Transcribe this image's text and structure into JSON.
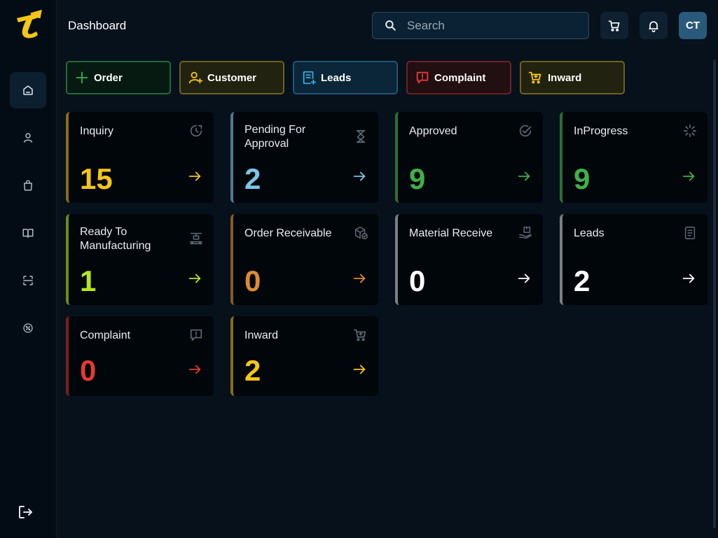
{
  "header": {
    "title": "Dashboard",
    "search_placeholder": "Search",
    "avatar_initials": "CT"
  },
  "sidebar": {
    "items": [
      {
        "name": "home-icon",
        "active": true
      },
      {
        "name": "user-icon",
        "active": false
      },
      {
        "name": "bag-icon",
        "active": false
      },
      {
        "name": "book-icon",
        "active": false
      },
      {
        "name": "scan-icon",
        "active": false
      },
      {
        "name": "discount-icon",
        "active": false
      }
    ],
    "logout_icon": "logout-icon"
  },
  "quick_actions": [
    {
      "label": "Order",
      "icon": "plus-icon",
      "color": "#2fa24b"
    },
    {
      "label": "Customer",
      "icon": "user-add-icon",
      "color": "#f5c518"
    },
    {
      "label": "Leads",
      "icon": "document-add-icon",
      "color": "#3aa8e0"
    },
    {
      "label": "Complaint",
      "icon": "alert-message-icon",
      "color": "#e53935"
    },
    {
      "label": "Inward",
      "icon": "cart-add-icon",
      "color": "#f5c518"
    }
  ],
  "cards": [
    {
      "title": "Inquiry",
      "value": "15",
      "color": "#f5c518",
      "icon": "clock-icon"
    },
    {
      "title": "Pending For Approval",
      "value": "2",
      "color": "#7cc5e6",
      "icon": "hourglass-icon"
    },
    {
      "title": "Approved",
      "value": "9",
      "color": "#3fb04a",
      "icon": "check-circle-icon"
    },
    {
      "title": "InProgress",
      "value": "9",
      "color": "#3fb04a",
      "icon": "loader-icon"
    },
    {
      "title": "Ready To Manufacturing",
      "value": "1",
      "color": "#b5e61d",
      "icon": "machine-icon"
    },
    {
      "title": "Order Receivable",
      "value": "0",
      "color": "#e08a2e",
      "icon": "package-check-icon"
    },
    {
      "title": "Material Receive",
      "value": "0",
      "color": "#ffffff",
      "icon": "hand-box-icon"
    },
    {
      "title": "Leads",
      "value": "2",
      "color": "#ffffff",
      "icon": "note-icon"
    },
    {
      "title": "Complaint",
      "value": "0",
      "color": "#e53935",
      "icon": "alert-message-icon"
    },
    {
      "title": "Inward",
      "value": "2",
      "color": "#f5c518",
      "icon": "cart-add-icon"
    }
  ]
}
